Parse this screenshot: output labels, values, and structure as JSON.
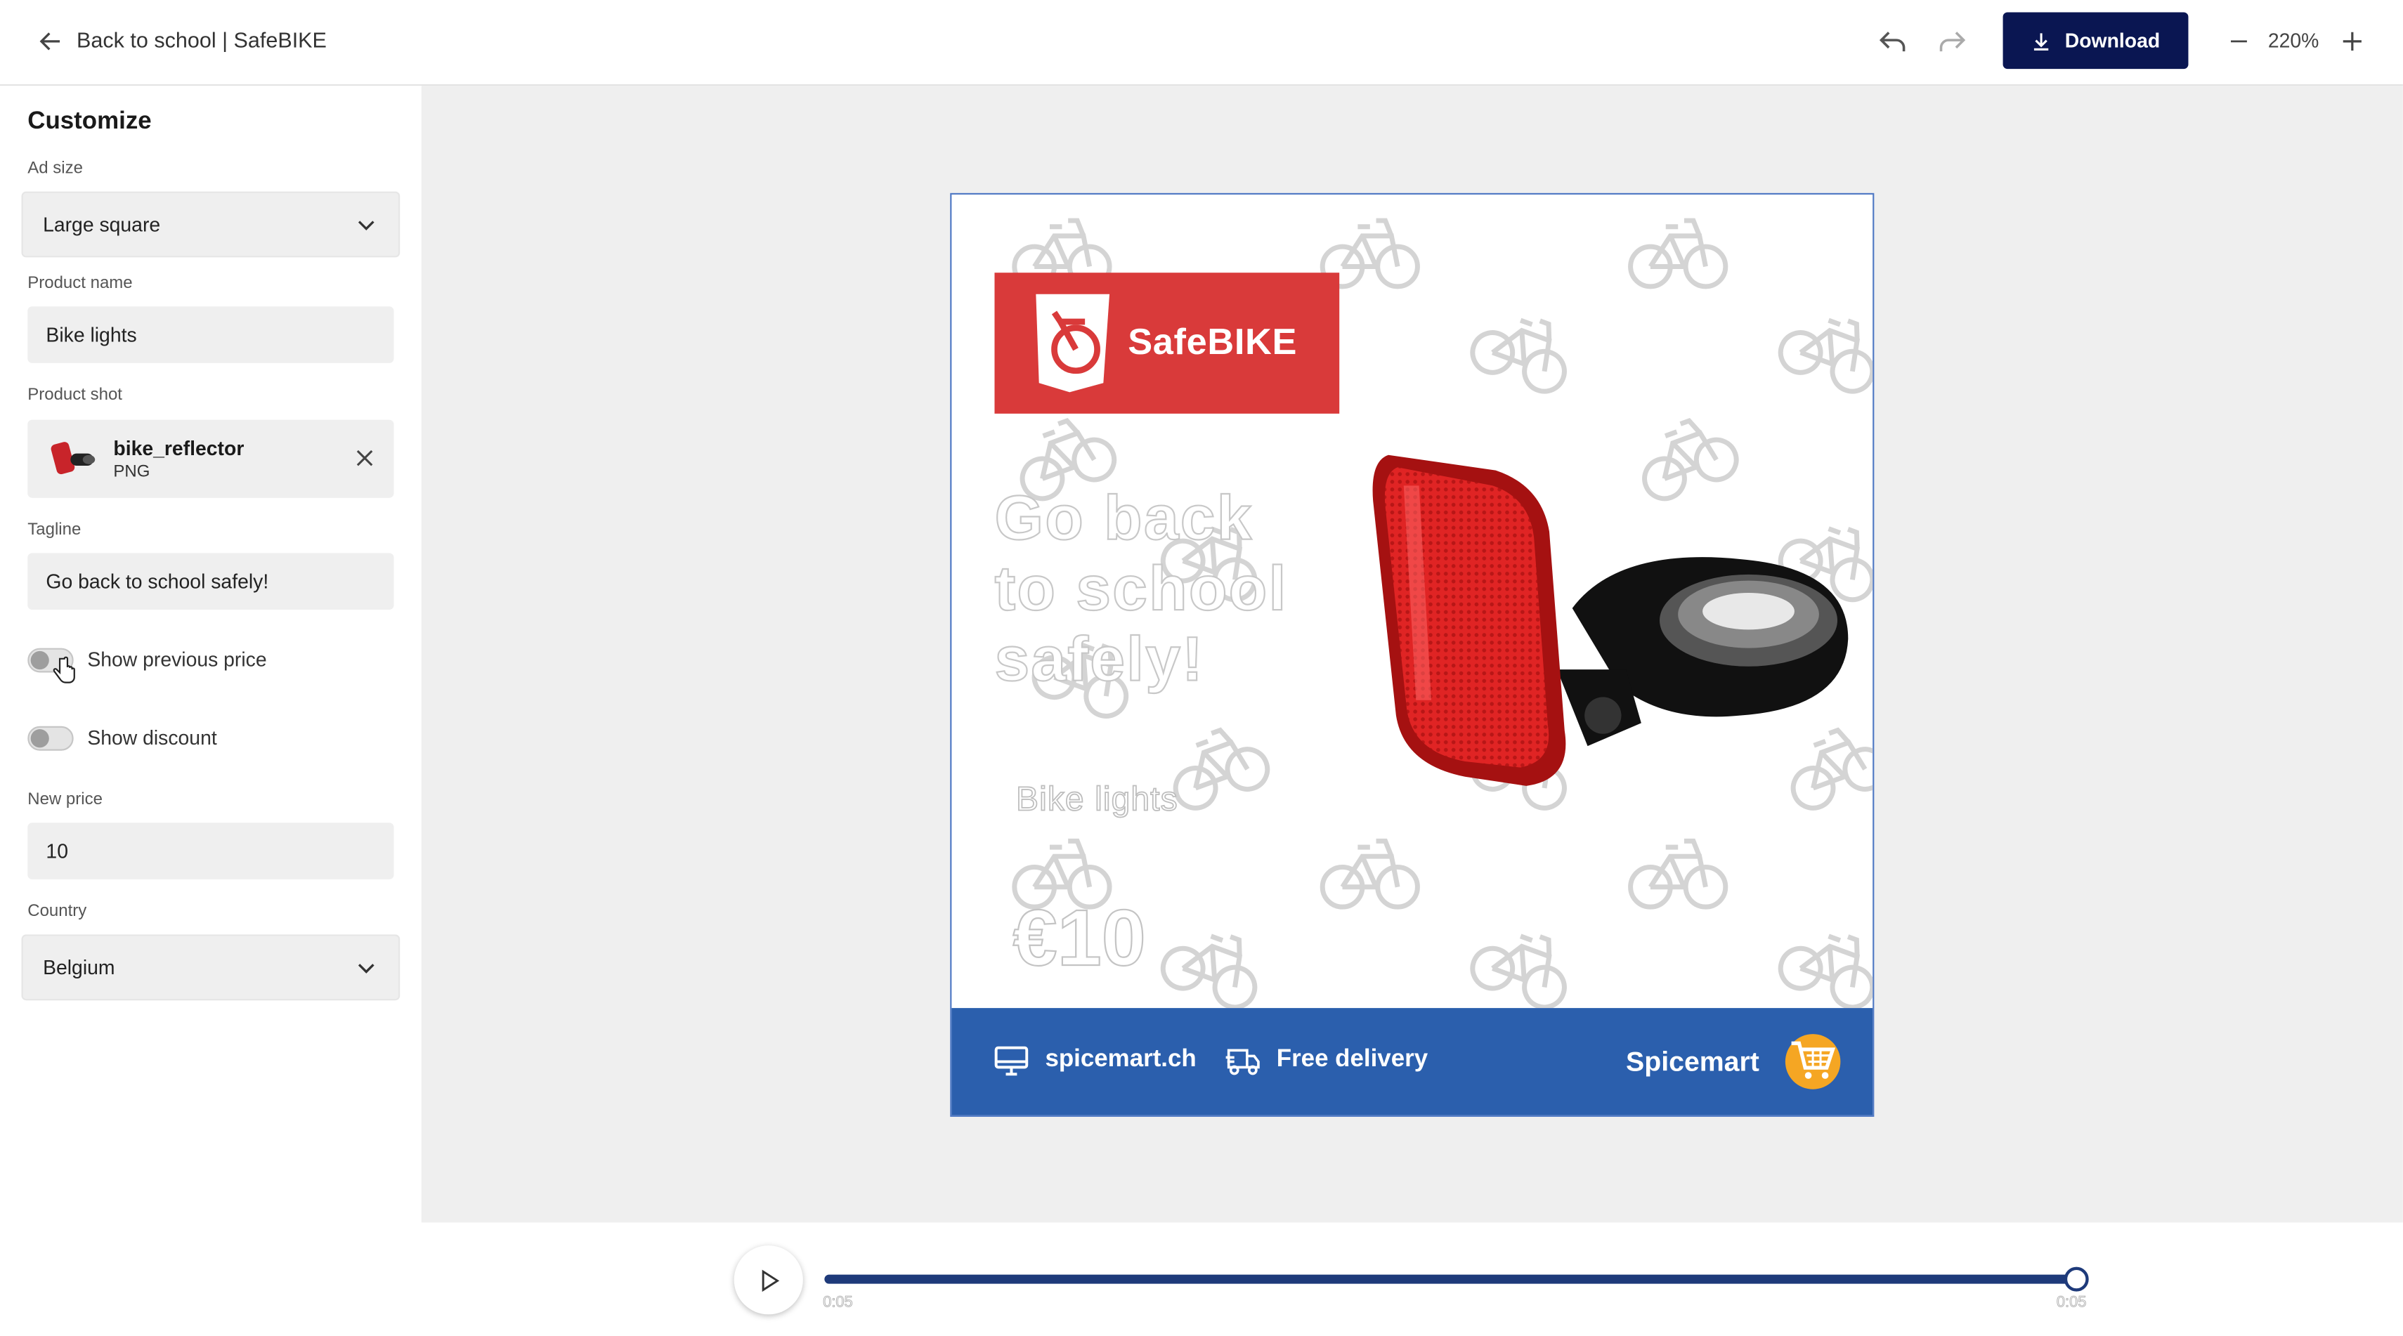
{
  "header": {
    "title": "Back to school | SafeBIKE",
    "download_label": "Download",
    "zoom": "220%",
    "icons": [
      "arrow-left-icon",
      "undo-icon",
      "redo-icon",
      "download-icon",
      "minus-icon",
      "plus-icon"
    ]
  },
  "sidebar": {
    "title": "Customize",
    "ad_size": {
      "label": "Ad size",
      "value": "Large square"
    },
    "product_name": {
      "label": "Product name",
      "value": "Bike lights"
    },
    "product_shot": {
      "label": "Product shot",
      "file_name": "bike_reflector",
      "file_type": "PNG"
    },
    "tagline": {
      "label": "Tagline",
      "value": "Go back to school safely!"
    },
    "show_previous_price": {
      "label": "Show previous price",
      "checked": false
    },
    "show_discount": {
      "label": "Show discount",
      "checked": false
    },
    "new_price": {
      "label": "New price",
      "value": "10"
    },
    "country": {
      "label": "Country",
      "value": "Belgium"
    }
  },
  "ad": {
    "brand_logo": "SafeBIKE",
    "tagline_line1": "Go back",
    "tagline_line2": "to school",
    "tagline_line3": "safely!",
    "product_name": "Bike lights",
    "price": "€10",
    "footer": {
      "website": "spicemart.ch",
      "delivery": "Free delivery",
      "brand": "Spicemart"
    },
    "colors": {
      "logo_red": "#d93a3a",
      "footer_blue": "#2b5fad",
      "cart_orange": "#f5a623"
    }
  },
  "timeline": {
    "start_time": "0:05",
    "end_time": "0:05",
    "progress": 1.0
  }
}
